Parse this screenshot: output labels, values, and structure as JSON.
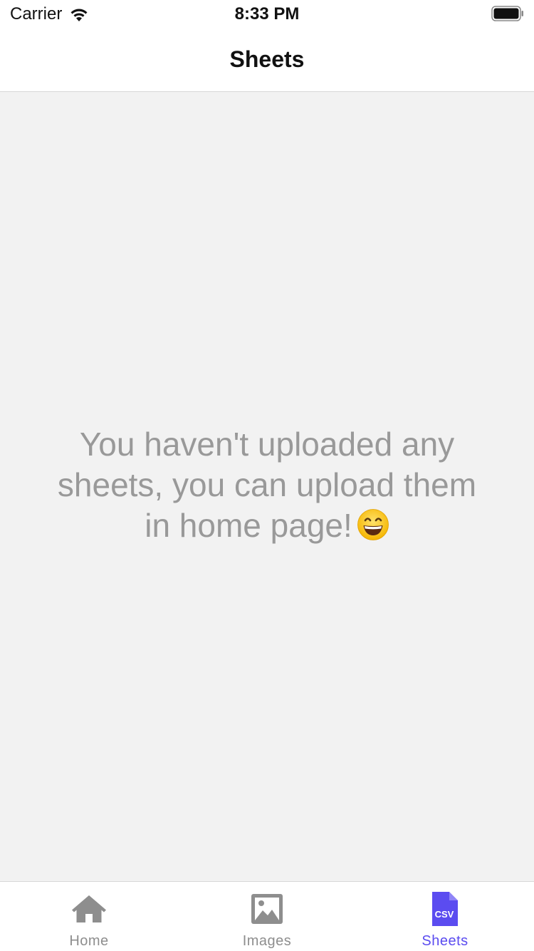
{
  "status_bar": {
    "carrier": "Carrier",
    "time": "8:33 PM",
    "wifi_icon": "wifi-icon",
    "battery_icon": "battery-icon"
  },
  "header": {
    "title": "Sheets"
  },
  "main": {
    "empty_message": "You haven't uploaded any sheets, you can upload them in home page!",
    "emoji_icon": "grinning-face-icon"
  },
  "tab_bar": {
    "active_color": "#5b4cf0",
    "inactive_color": "#8e8e8e",
    "tabs": [
      {
        "label": "Home",
        "icon": "home-icon",
        "active": false
      },
      {
        "label": "Images",
        "icon": "image-icon",
        "active": false
      },
      {
        "label": "Sheets",
        "icon": "csv-file-icon",
        "active": true,
        "icon_text": "CSV"
      }
    ]
  }
}
